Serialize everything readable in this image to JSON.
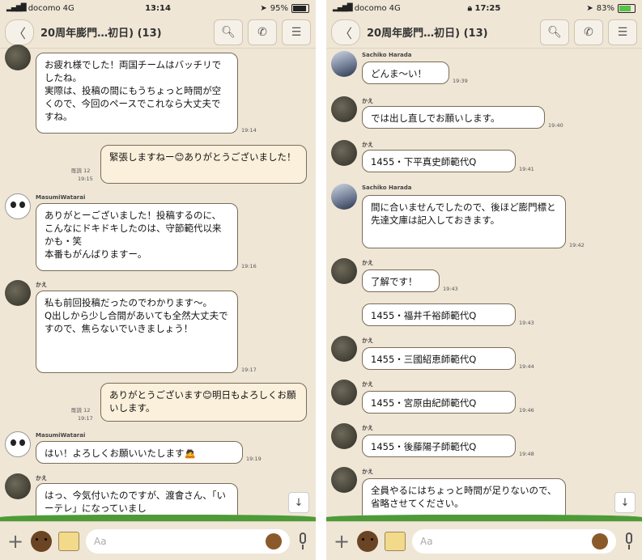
{
  "left": {
    "status": {
      "carrier": "docomo",
      "network": "4G",
      "time": "13:14",
      "battery": "95%",
      "battery_level": 0.95
    },
    "header": {
      "title": "20周年膨門…初日)",
      "count": "(13)"
    },
    "footer": {
      "placeholder": "Aa"
    },
    "messages": [
      {
        "side": "left",
        "sender": "",
        "avatar": "kae",
        "text": "お疲れ様でした！両国チームはバッチリでしたね。\n実際は、投稿の間にもうちょっと時間が空くので、今回のペースでこれなら大丈夫ですね。",
        "time": "19:14"
      },
      {
        "side": "right",
        "read": "既読 12",
        "text": "緊張しますねー😊ありがとうございました！",
        "time": "19:15"
      },
      {
        "side": "left",
        "sender": "MasumiWatarai",
        "avatar": "panda",
        "text": "ありがとーございました！投稿するのに、こんなにドキドキしたのは、守節範代以来かも・笑\n本番もがんばりますー。",
        "time": "19:16"
      },
      {
        "side": "left",
        "sender": "かえ",
        "avatar": "kae",
        "text": "私も前回投稿だったのでわかります〜。\nQ出しから少し合間があいても全然大丈夫ですので、焦らないでいきましょう！",
        "time": "19:17"
      },
      {
        "side": "right",
        "read": "既読 12",
        "text": "ありがとうございます😊明日もよろしくお願いします。",
        "time": "19:17"
      },
      {
        "side": "left",
        "sender": "MasumiWatarai",
        "avatar": "panda",
        "text": "はい！よろしくお願いいたします🙇",
        "time": "19:19"
      },
      {
        "side": "left",
        "sender": "かえ",
        "avatar": "kae",
        "text": "はっ、今気付いたのですが、渡會さん、「いーテレ」になっていまし",
        "time": ""
      }
    ]
  },
  "right": {
    "status": {
      "carrier": "docomo",
      "network": "4G",
      "time": "17:25",
      "battery": "83%",
      "battery_level": 0.83
    },
    "header": {
      "title": "20周年膨門…初日)",
      "count": "(13)"
    },
    "footer": {
      "placeholder": "Aa"
    },
    "messages": [
      {
        "side": "left",
        "sender": "Sachiko Harada",
        "avatar": "woman",
        "text": "どんま〜い！",
        "time": "19:39"
      },
      {
        "side": "left",
        "sender": "かえ",
        "avatar": "kae",
        "text": "では出し直しでお願いします。",
        "time": "19:40"
      },
      {
        "side": "left",
        "sender": "かえ",
        "avatar": "kae",
        "text": "1455・下平真史師範代Q",
        "time": "19:41"
      },
      {
        "side": "left",
        "sender": "Sachiko Harada",
        "avatar": "woman",
        "text": "間に合いませんでしたので、後ほど膨門標と先達文庫は記入しておきます。",
        "time": "19:42"
      },
      {
        "side": "left",
        "sender": "かえ",
        "avatar": "kae",
        "text": "了解です！",
        "time": "19:43"
      },
      {
        "side": "left",
        "sender": "",
        "avatar": "",
        "text": "1455・福井千裕師範代Q",
        "time": "19:43"
      },
      {
        "side": "left",
        "sender": "かえ",
        "avatar": "kae",
        "text": "1455・三國紹恵師範代Q",
        "time": "19:44"
      },
      {
        "side": "left",
        "sender": "かえ",
        "avatar": "kae",
        "text": "1455・宮原由紀師範代Q",
        "time": "19:46"
      },
      {
        "side": "left",
        "sender": "かえ",
        "avatar": "kae",
        "text": "1455・後藤陽子師範代Q",
        "time": "19:48"
      },
      {
        "side": "left",
        "sender": "かえ",
        "avatar": "kae",
        "text": "全員やるにはちょっと時間が足りないので、省略させてください。",
        "time": ""
      }
    ]
  }
}
